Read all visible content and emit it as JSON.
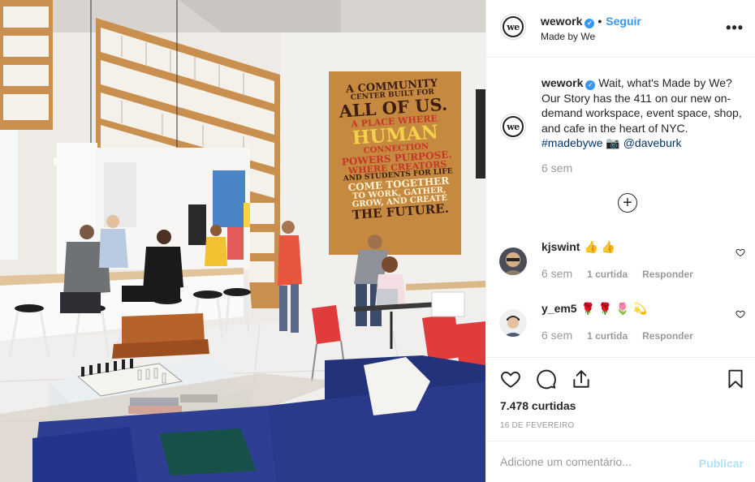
{
  "header": {
    "username": "wework",
    "verified_mark": "✓",
    "separator": "•",
    "follow_label": "Seguir",
    "location": "Made by We",
    "more_glyph": "•••"
  },
  "avatar_text": "we",
  "caption": {
    "username": "wework",
    "text": "Wait, what's Made by We? Our Story has the 411 on our new on-demand workspace, event space, shop, and cafe in the heart of NYC.",
    "hashtag": "#madebywe",
    "camera_glyph": "📷",
    "mention": "@daveburk",
    "time": "6 sem"
  },
  "load_more_glyph": "+",
  "comments": [
    {
      "username": "kjswint",
      "text": "👍 👍",
      "time": "6 sem",
      "likes": "1 curtida",
      "reply": "Responder"
    },
    {
      "username": "y_em5",
      "text": "🌹 🌹 🌷 💫",
      "time": "6 sem",
      "likes": "1 curtida",
      "reply": "Responder"
    }
  ],
  "engagement": {
    "likes": "7.478 curtidas",
    "date": "16 DE FEVEREIRO"
  },
  "comment_box": {
    "placeholder": "Adicione um comentário...",
    "publish_label": "Publicar"
  },
  "photo": {
    "mural_lines": [
      "A COMMUNITY",
      "CENTER BUILT FOR",
      "ALL OF US.",
      "A PLACE WHERE",
      "HUMAN",
      "CONNECTION",
      "POWERS PURPOSE.",
      "WHERE CREATORS",
      "AND STUDENTS FOR LIFE",
      "COME TOGETHER",
      "TO WORK, GATHER,",
      "GROW, AND CREATE",
      "THE FUTURE."
    ]
  },
  "icons": {
    "heart": "heart-icon",
    "comment": "comment-icon",
    "share": "share-icon",
    "bookmark": "bookmark-icon",
    "more": "more-options-icon",
    "plus": "plus-circle-icon"
  },
  "colors": {
    "accent_blue": "#3897f0",
    "publish_disabled": "#b2dffc",
    "meta_gray": "#999999",
    "link_navy": "#003569",
    "border": "#efefef"
  }
}
